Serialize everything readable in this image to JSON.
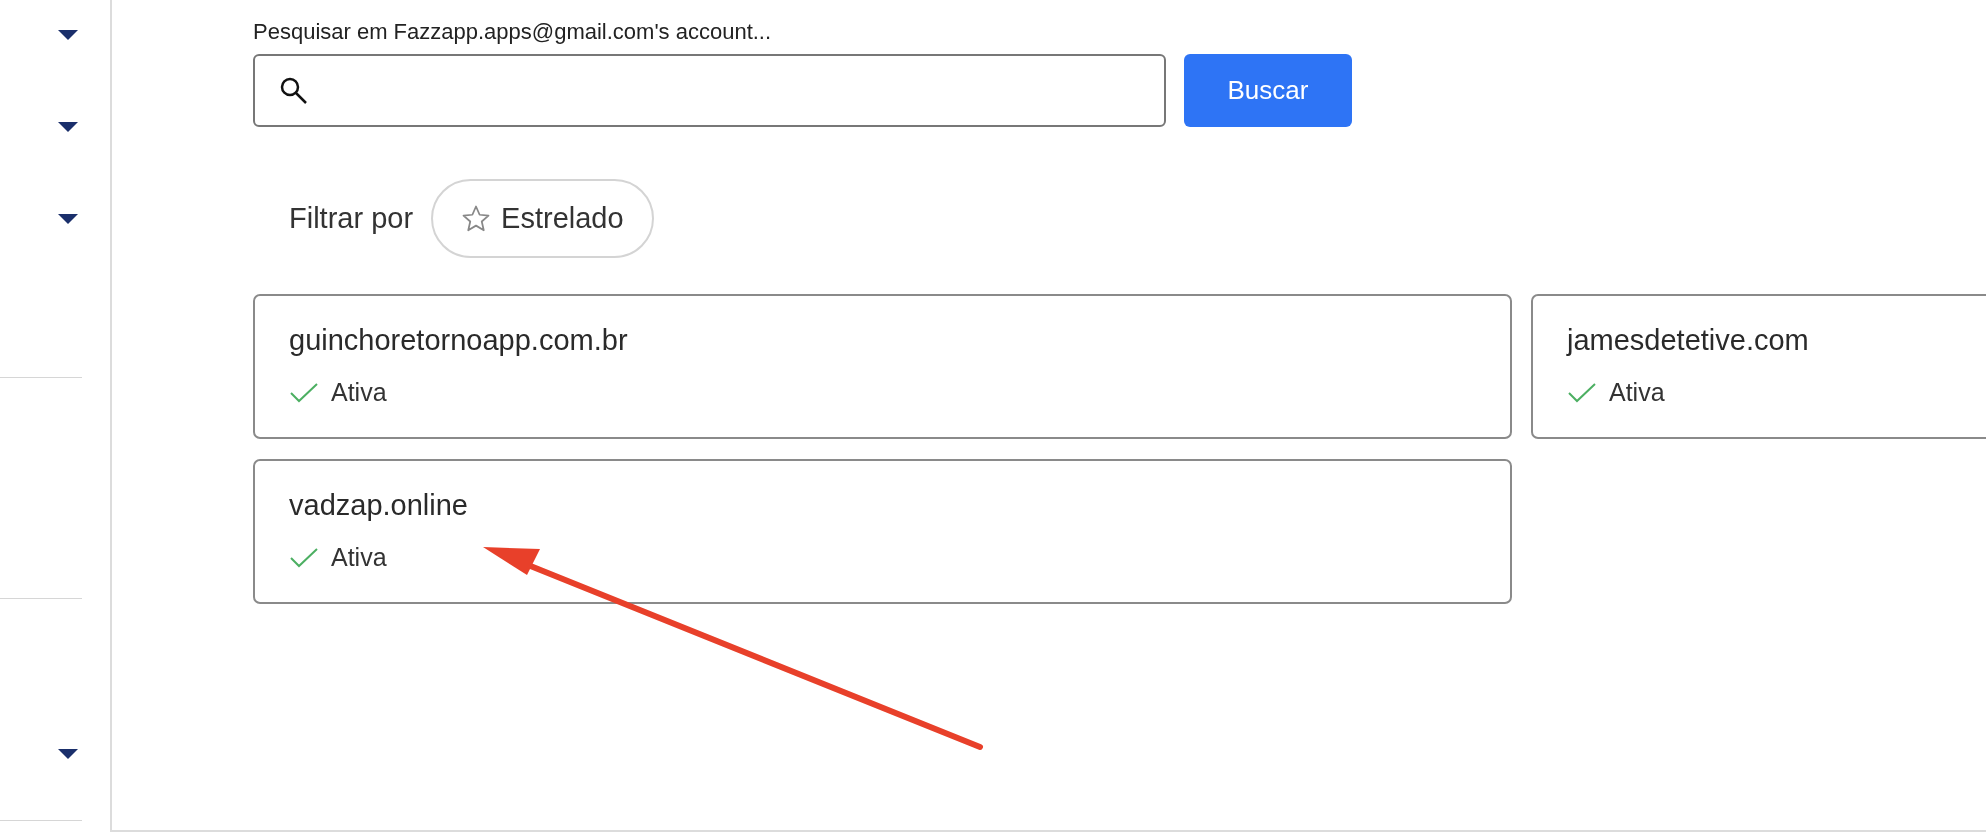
{
  "sidebar": {
    "sections": [
      {
        "kind": "group",
        "items": [
          {
            "expanded": false
          },
          {
            "expanded": false
          },
          {
            "expanded": false
          }
        ]
      },
      {
        "kind": "blank"
      },
      {
        "kind": "group",
        "items": [
          {
            "expanded": false
          }
        ]
      }
    ]
  },
  "search": {
    "label": "Pesquisar em Fazzapp.apps@gmail.com's account...",
    "button": "Buscar"
  },
  "filter": {
    "label": "Filtrar por",
    "chips": [
      {
        "label": "Estrelado",
        "selected": false
      }
    ]
  },
  "domains": [
    {
      "name": "guinchoretornoapp.com.br",
      "status": "Ativa"
    },
    {
      "name": "jamesdetetive.com",
      "status": "Ativa"
    },
    {
      "name": "vadzap.online",
      "status": "Ativa"
    }
  ]
}
